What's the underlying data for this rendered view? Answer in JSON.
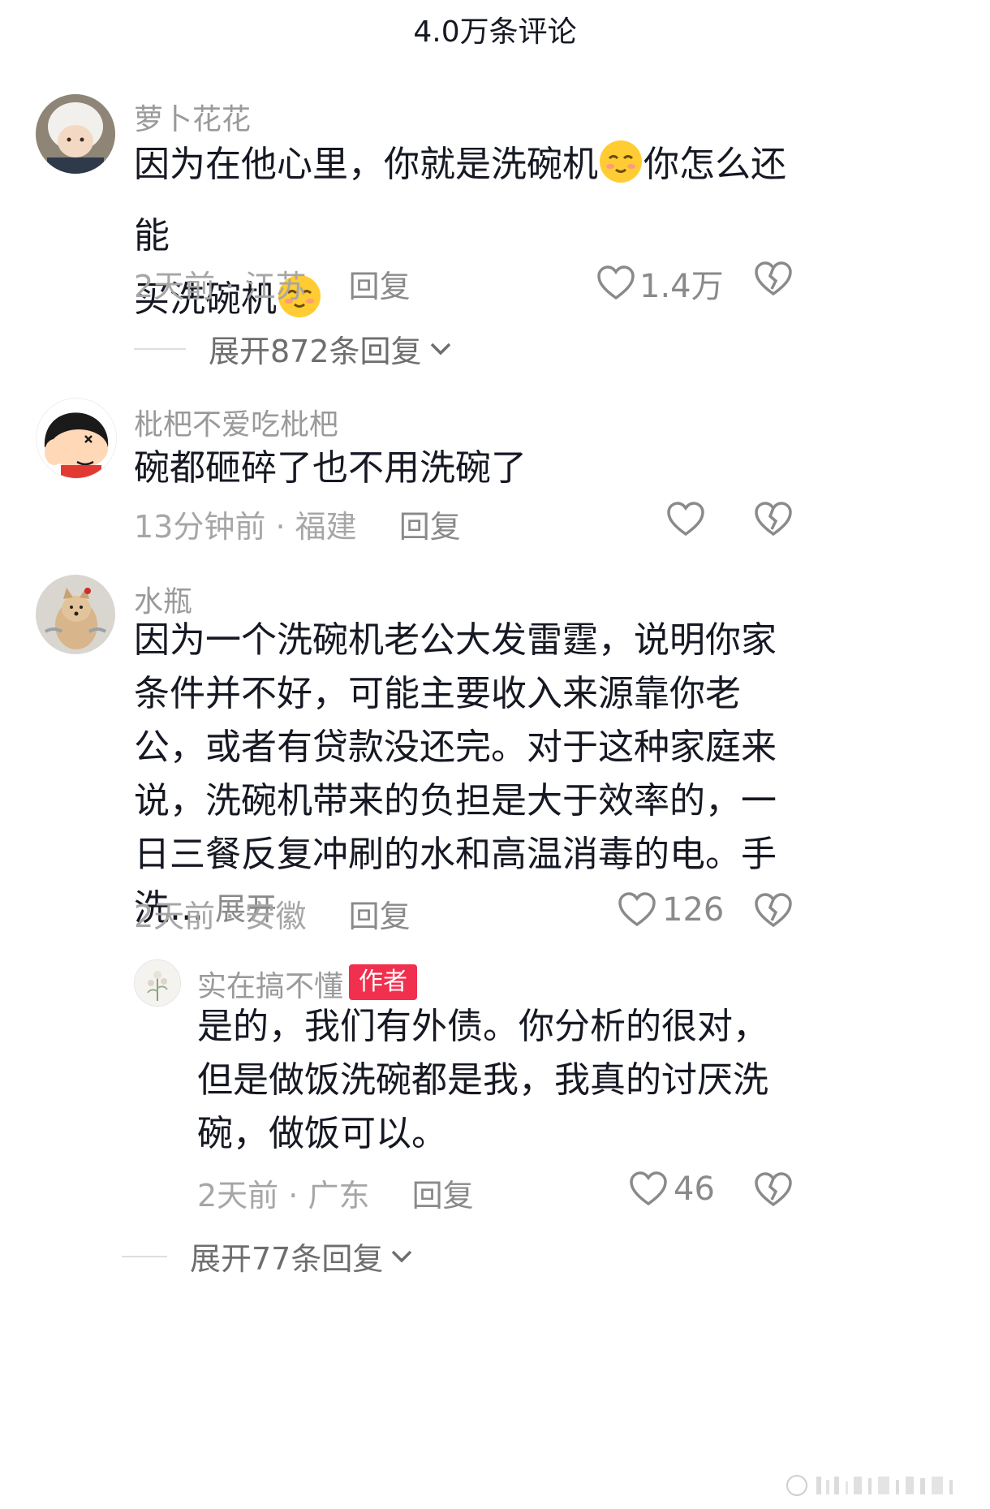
{
  "header": {
    "title": "4.0万条评论"
  },
  "comments": [
    {
      "username": "萝卜花花",
      "text_part1": "因为在他心里，你就是洗碗机",
      "text_part2": "你怎么还能",
      "text_part3": "买洗碗机",
      "time": "2天前",
      "region": "江苏",
      "reply_label": "回复",
      "likes": "1.4万",
      "expand_label": "展开872条回复"
    },
    {
      "username": "枇杷不爱吃枇杷",
      "text": "碗都砸碎了也不用洗碗了",
      "time": "13分钟前",
      "region": "福建",
      "reply_label": "回复",
      "likes": ""
    },
    {
      "username": "水瓶",
      "text": "因为一个洗碗机老公大发雷霆，说明你家条件并不好，可能主要收入来源靠你老公，或者有贷款没还完。对于这种家庭来说，洗碗机带来的负担是大于效率的，一日三餐反复冲刷的水和高温消毒的电。手洗...",
      "more_label": "展开",
      "time": "2天前",
      "region": "安徽",
      "reply_label": "回复",
      "likes": "126"
    }
  ],
  "reply": {
    "username": "实在搞不懂",
    "badge": "作者",
    "text": "是的，我们有外债。你分析的很对，但是做饭洗碗都是我，我真的讨厌洗碗，做饭可以。",
    "time": "2天前",
    "region": "广东",
    "reply_label": "回复",
    "likes": "46",
    "expand_label": "展开77条回复"
  },
  "separator": "·",
  "icons": {
    "like": "heart-outline-icon",
    "dislike": "broken-heart-icon",
    "chevron": "chevron-down-icon",
    "emoji": "smiling-face-emoji"
  },
  "colors": {
    "author_badge": "#f0304e",
    "meta_text": "#a6a6a6"
  }
}
